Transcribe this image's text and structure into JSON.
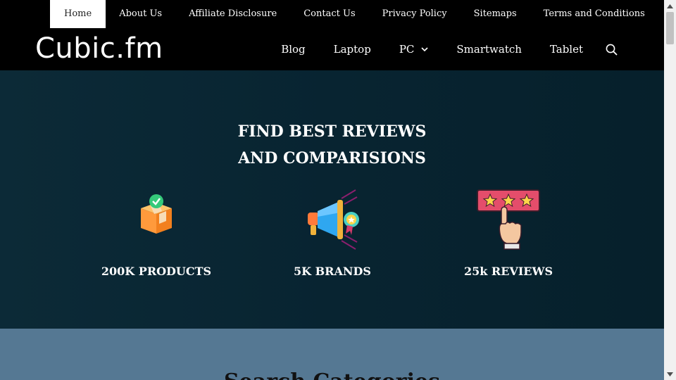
{
  "topnav": {
    "items": [
      {
        "label": "Home"
      },
      {
        "label": "About Us"
      },
      {
        "label": "Affiliate Disclosure"
      },
      {
        "label": "Contact Us"
      },
      {
        "label": "Privacy Policy"
      },
      {
        "label": "Sitemaps"
      },
      {
        "label": "Terms and Conditions"
      }
    ],
    "active": "Home"
  },
  "header": {
    "logo": "Cubic.fm",
    "nav": [
      {
        "label": "Blog"
      },
      {
        "label": "Laptop"
      },
      {
        "label": "PC"
      },
      {
        "label": "Smartwatch"
      },
      {
        "label": "Tablet"
      }
    ],
    "search_icon": "search-icon"
  },
  "hero": {
    "title_line1": "FIND BEST REVIEWS",
    "title_line2": "AND COMPARISIONS",
    "stats": [
      {
        "label": "200K PRODUCTS",
        "icon": "box-check-icon"
      },
      {
        "label": "5K BRANDS",
        "icon": "megaphone-badge-icon"
      },
      {
        "label": "25k REVIEWS",
        "icon": "star-rating-hand-icon"
      }
    ]
  },
  "categories": {
    "title": "Search Categories"
  },
  "colors": {
    "nav_bg": "#000000",
    "hero_bg": "#082431",
    "band_bg": "#557893"
  }
}
